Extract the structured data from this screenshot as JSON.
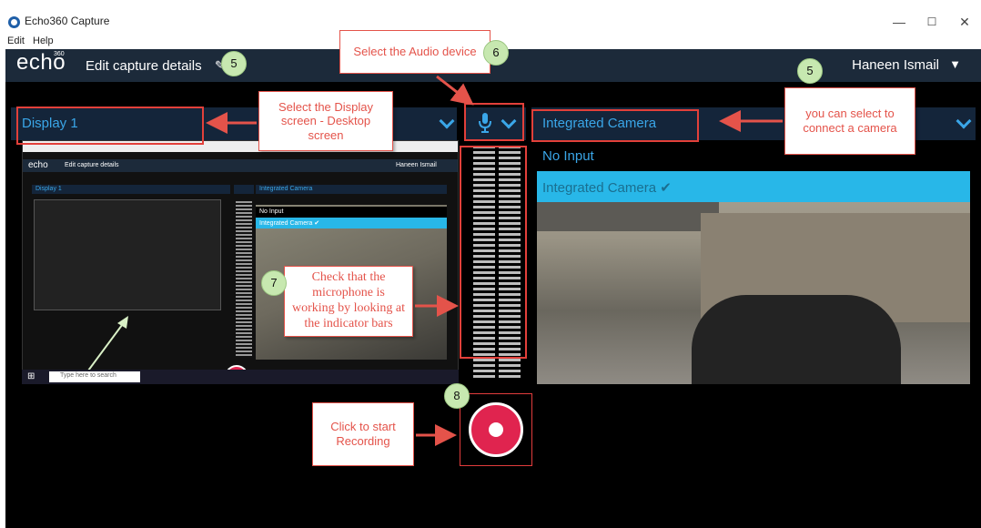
{
  "window": {
    "title": "Echo360 Capture",
    "minimize": "—",
    "maximize": "☐",
    "close": "✕"
  },
  "menu": {
    "items": [
      "Edit",
      "Help"
    ]
  },
  "header": {
    "logo": "echo",
    "logo_sup": "360",
    "title": "Edit capture details",
    "user": "Haneen Ismail"
  },
  "display": {
    "selected": "Display 1"
  },
  "camera": {
    "selected": "Integrated Camera",
    "options": [
      {
        "label": "No Input",
        "selected": false
      },
      {
        "label": "Integrated Camera ✔",
        "selected": true
      }
    ]
  },
  "mini": {
    "header_title": "Edit capture details",
    "user": "Haneen Ismail",
    "display": "Display 1",
    "camera": "Integrated Camera",
    "no_input": "No Input",
    "selected_camera": "Integrated Camera ✔",
    "search_placeholder": "Type here to search"
  },
  "annotations": {
    "display_callout": "Select the Display screen - Desktop screen",
    "audio_callout": "Select the Audio device",
    "camera_callout": "you can select to connect a camera",
    "mic_callout": "Check that the microphone is working by looking at the indicator bars",
    "record_callout": "Click to start Recording",
    "badges": {
      "header": "5",
      "audio": "6",
      "camera": "5",
      "mic": "7",
      "record": "8"
    }
  },
  "colors": {
    "header_bg": "#1c2a3a",
    "source_bar_bg": "#14253a",
    "accent_blue": "#3aa6e8",
    "selected_option": "#28b7e8",
    "record_red": "#e0244f",
    "annotation_red": "#e4534a",
    "badge_green": "#c7e8b0"
  }
}
